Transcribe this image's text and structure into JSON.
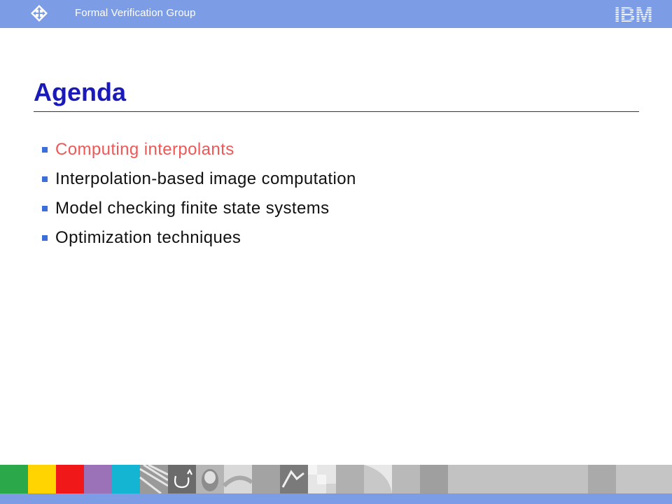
{
  "header": {
    "title": "Formal Verification Group",
    "logo_text": "IBM",
    "bar_color": "#7c9ce6"
  },
  "slide": {
    "title": "Agenda",
    "title_color": "#1a1ab8",
    "bullets": [
      {
        "label": "Computing interpolants",
        "highlighted": true
      },
      {
        "label": "Interpolation-based image computation",
        "highlighted": false
      },
      {
        "label": "Model checking finite state systems",
        "highlighted": false
      },
      {
        "label": "Optimization techniques",
        "highlighted": false
      }
    ],
    "highlight_color": "#f05757",
    "bullet_marker_color": "#3a6fd8"
  },
  "footer": {
    "color_tiles": [
      "#2aa84a",
      "#ffd400",
      "#f01818",
      "#9b72b8",
      "#13b5d3"
    ]
  }
}
